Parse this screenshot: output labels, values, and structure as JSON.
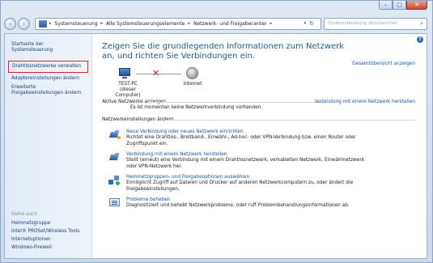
{
  "window": {
    "controls": {
      "minimize": "–",
      "maximize": "□",
      "close": "✕"
    }
  },
  "navigation": {
    "back": "‹",
    "forward": "›",
    "breadcrumbs": [
      "Systemsteuerung",
      "Alle Systemsteuerungselemente",
      "Netzwerk- und Freigabecenter"
    ],
    "separator": "▸",
    "dropdown": "▾",
    "refresh": "↻",
    "search_placeholder": "Systemsteuerung durchsuchen",
    "search_icon": "⌕"
  },
  "sidebar": {
    "items": [
      {
        "label": "Startseite der Systemsteuerung",
        "selected": false
      },
      {
        "label": "Drahtlosnetzwerke verwalten",
        "selected": true
      },
      {
        "label": "Adaptereinstellungen ändern",
        "selected": false
      },
      {
        "label": "Erweiterte Freigabeeinstellungen ändern",
        "selected": false
      }
    ],
    "see_also_heading": "Siehe auch",
    "see_also": [
      "Heimnetzgruppe",
      "Intel® PROSet/Wireless Tools",
      "Internetoptionen",
      "Windows-Firewall"
    ]
  },
  "main": {
    "help_icon": "?",
    "title": "Zeigen Sie die grundlegenden Informationen zum Netzwerk an, und richten Sie Verbindungen ein.",
    "full_map_link": "Gesamtübersicht anzeigen",
    "network_map": {
      "computer_label_1": "TEST-PC",
      "computer_label_2": "(dieser Computer)",
      "internet_label": "Internet",
      "status_mark": "✕"
    },
    "active_networks": {
      "label": "Aktive Netzwerke anzeigen",
      "link": "Verbindung mit einem Netzwerk herstellen",
      "message": "Es ist momentan keine Netzwerkverbindung vorhanden."
    },
    "settings_section_label": "Netzwerkeinstellungen ändern",
    "tasks": [
      {
        "icon": "new-connection-icon",
        "link": "Neue Verbindung oder neues Netzwerk einrichten",
        "desc": "Richtet eine Drahtlos-, Breitband-, Einwähl-, Ad-hoc- oder VPN-Verbindung bzw. einen Router oder Zugriffspunkt ein."
      },
      {
        "icon": "connect-network-icon",
        "link": "Verbindung mit einem Netzwerk herstellen",
        "desc": "Stellt (erneut) eine Verbindung mit einem Drahtlosnetzwerk, verkabelten Netzwerk, Einwählnetzwerk oder VPN-Netzwerk her."
      },
      {
        "icon": "homegroup-sharing-icon",
        "link": "Heimnetzgruppen- und Freigabeoptionen auswählen",
        "desc": "Ermöglicht Zugriff auf Dateien und Drucker auf anderen Netzwerkcomputern zu, oder ändert die Freigabeeinstellungen."
      },
      {
        "icon": "troubleshoot-icon",
        "link": "Probleme beheben",
        "desc": "Diagnostiziert und behebt Netzwerkprobleme, oder ruft Problembehandlungsinformationen ab."
      }
    ]
  }
}
